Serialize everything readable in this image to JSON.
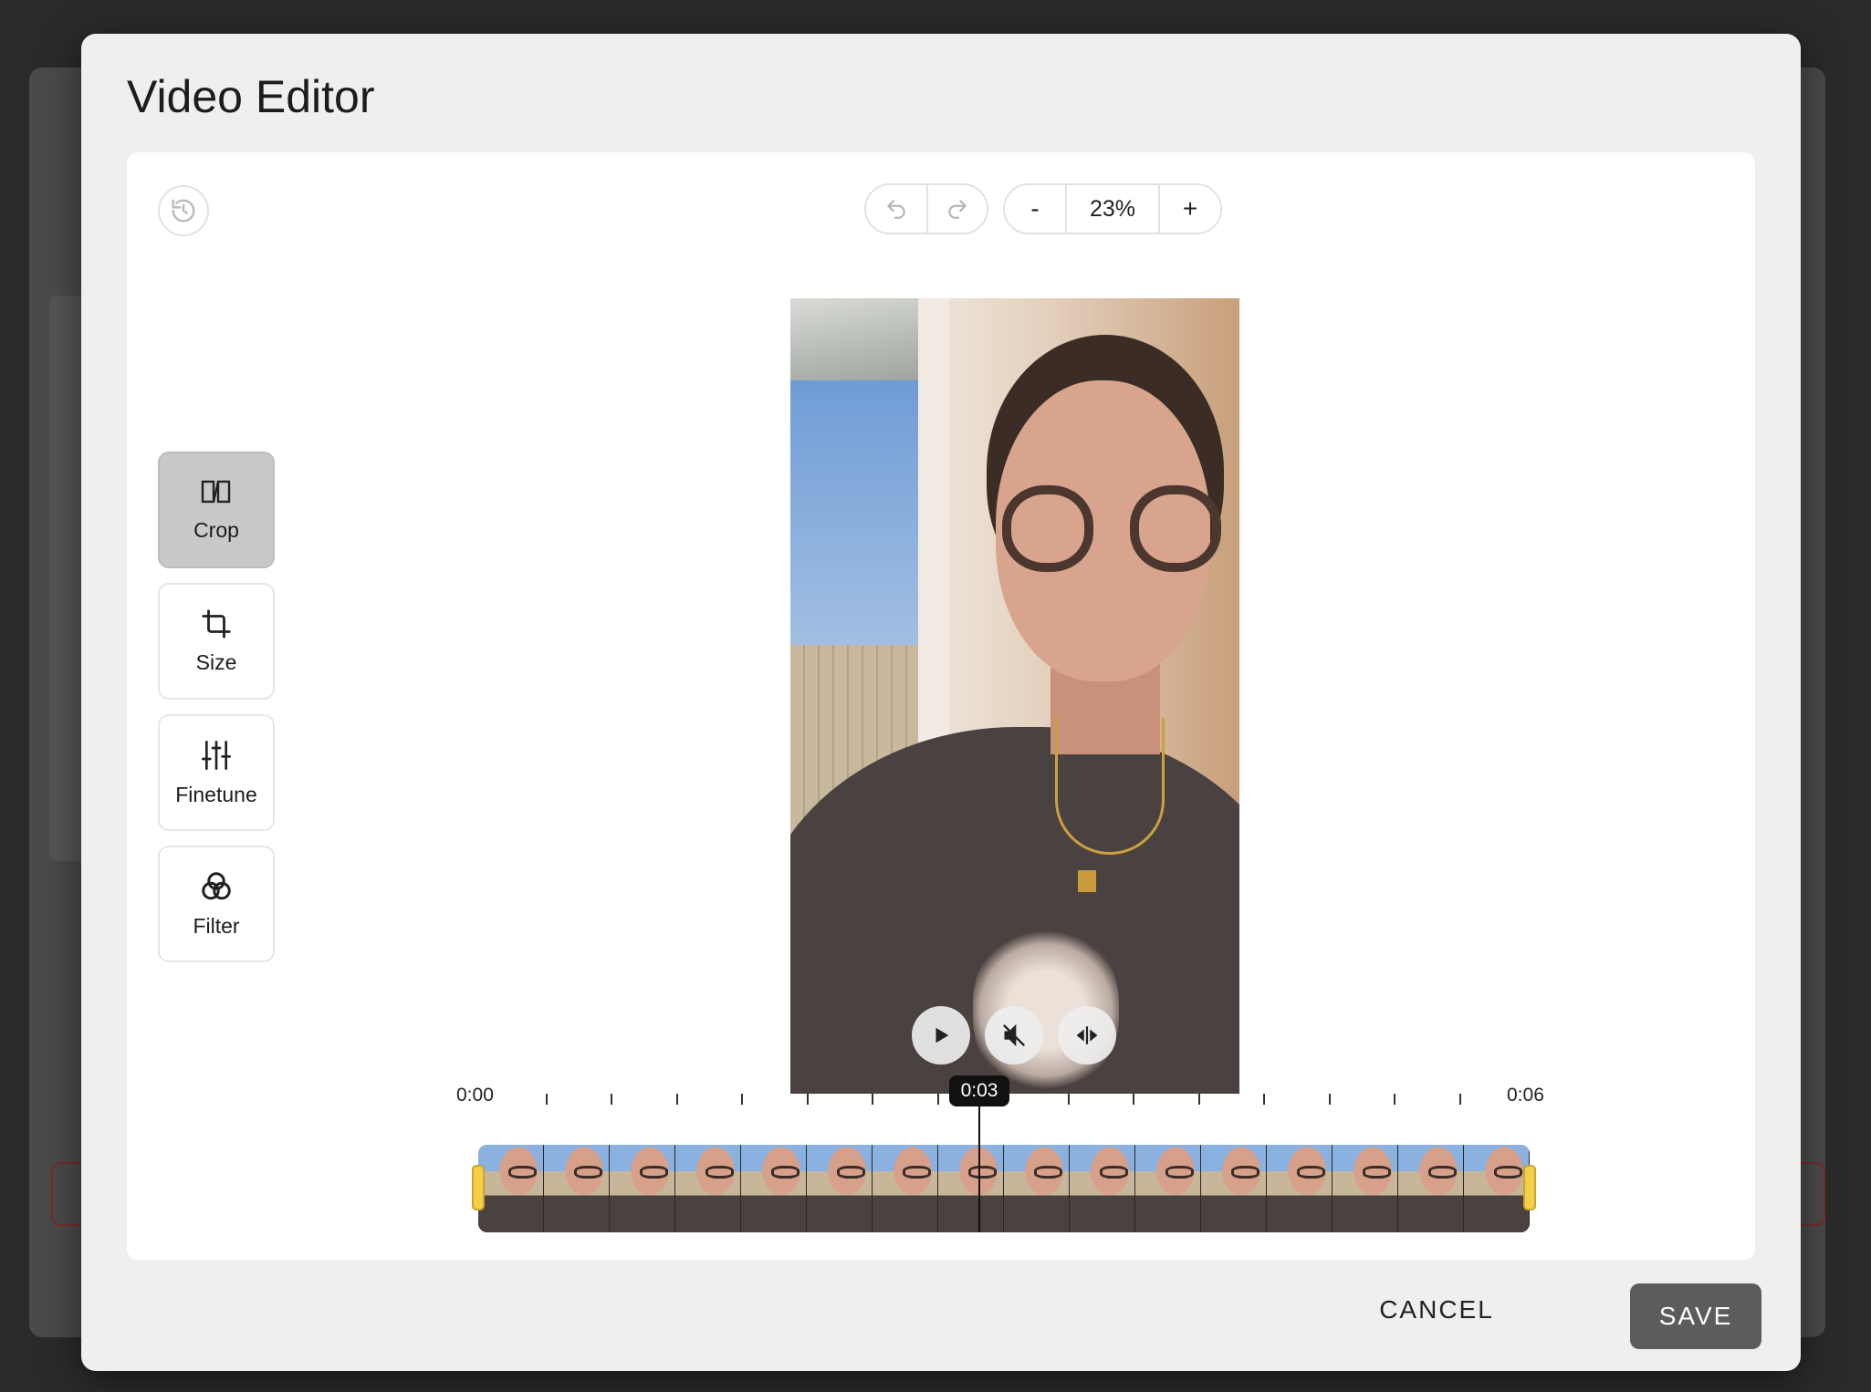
{
  "modal": {
    "title": "Video Editor",
    "cancel_label": "CANCEL",
    "save_label": "SAVE"
  },
  "toolbar": {
    "zoom_out_label": "-",
    "zoom_value": "23%",
    "zoom_in_label": "+"
  },
  "tools": [
    {
      "label": "Crop",
      "icon": "crop-frame-icon",
      "active": true
    },
    {
      "label": "Size",
      "icon": "crop-icon",
      "active": false
    },
    {
      "label": "Finetune",
      "icon": "sliders-icon",
      "active": false
    },
    {
      "label": "Filter",
      "icon": "filter-circles-icon",
      "active": false
    }
  ],
  "timeline": {
    "start_label": "0:00",
    "end_label": "0:06",
    "playhead_label": "0:03"
  },
  "colors": {
    "modal_bg": "#efefef",
    "active_tool": "#c9c9c9",
    "save_button": "#5c5c5c",
    "trim_handle": "#f4d04a"
  }
}
